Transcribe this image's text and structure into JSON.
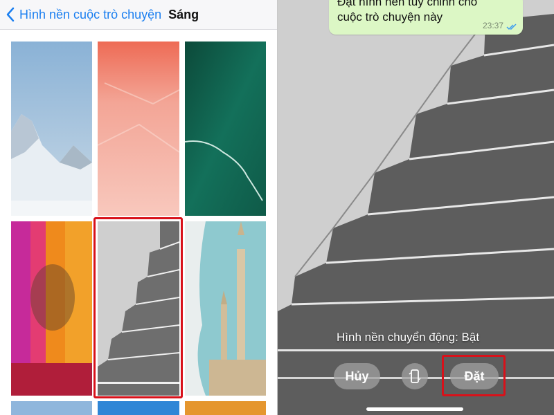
{
  "left": {
    "nav": {
      "back_label": "Hình nền cuộc trò chuyện",
      "title": "Sáng",
      "back_icon": "chevron-left-icon",
      "accent_color": "#1b7ff0"
    },
    "wallpapers": [
      {
        "name": "snowy-mountain"
      },
      {
        "name": "coral-pink"
      },
      {
        "name": "teal-ocean"
      },
      {
        "name": "colorful-fabrics"
      },
      {
        "name": "stepped-pyramid",
        "selected": true
      },
      {
        "name": "minaret-mosque"
      }
    ],
    "selection_color": "#d8111a"
  },
  "right": {
    "message": {
      "text": "Đặt hình nền tùy chỉnh cho cuộc trò chuyện này",
      "time": "23:37",
      "status_icon": "double-check-icon"
    },
    "motion_label": "Hình nền chuyển động: Bật",
    "buttons": {
      "cancel": "Hủy",
      "set": "Đặt",
      "device_icon": "phone-rotate-icon"
    }
  }
}
